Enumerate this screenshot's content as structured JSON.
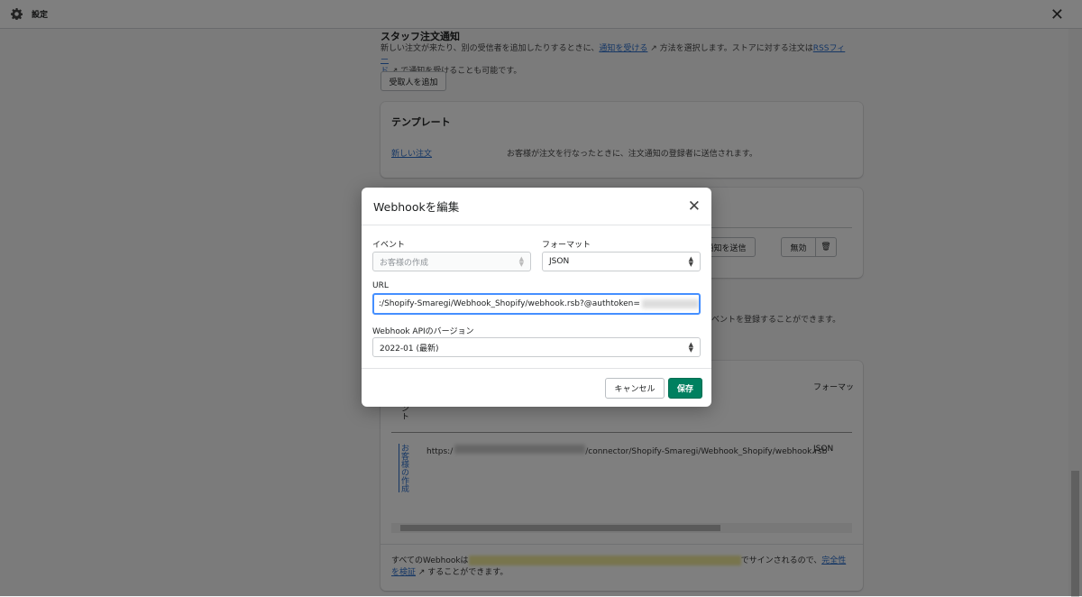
{
  "topbar": {
    "title": "設定",
    "close_icon": "close-icon",
    "gear_icon": "gear-icon"
  },
  "staff": {
    "heading": "スタッフ注文通知",
    "desc_1": "新しい注文が来たり、別の受信者を追加したりするときに、",
    "link_1": "通知を受ける",
    "desc_2": " 方法を選択します。ストアに対する注文は",
    "link_2a": "RSSフィー",
    "link_2b": "ド",
    "desc_3": " で通知を受けることも可能です。",
    "add_button": "受取人を追加"
  },
  "template": {
    "heading": "テンプレート",
    "item_link": "新しい注文",
    "item_desc": "お客様が注文を行なったときに、注文通知の登録者に送信されます。"
  },
  "recipient_card": {
    "send_button": "通知を送信",
    "disable_button": "無効"
  },
  "webhooks": {
    "desc_tail": "イベントを登録することができます。",
    "col_event": "イベント",
    "col_format": "フォーマッ",
    "row": {
      "event": "お客様の作成",
      "url_prefix": "https:/",
      "url_suffix": "/connector/Shopify-Smaregi/Webhook_Shopify/webhook.rsb",
      "format": "JSON"
    },
    "footer_1": "すべてのWebhookは",
    "footer_2": "でサインされるので、",
    "footer_link_a": "完全性",
    "footer_link_b": "を検証",
    "footer_3": " することができます。"
  },
  "modal": {
    "title": "Webhookを編集",
    "event_label": "イベント",
    "event_value": "お客様の作成",
    "format_label": "フォーマット",
    "format_value": "JSON",
    "url_label": "URL",
    "url_value": ":/Shopify-Smaregi/Webhook_Shopify/webhook.rsb?@authtoken=",
    "version_label": "Webhook APIのバージョン",
    "version_value": "2022-01 (最新)",
    "cancel": "キャンセル",
    "save": "保存"
  }
}
